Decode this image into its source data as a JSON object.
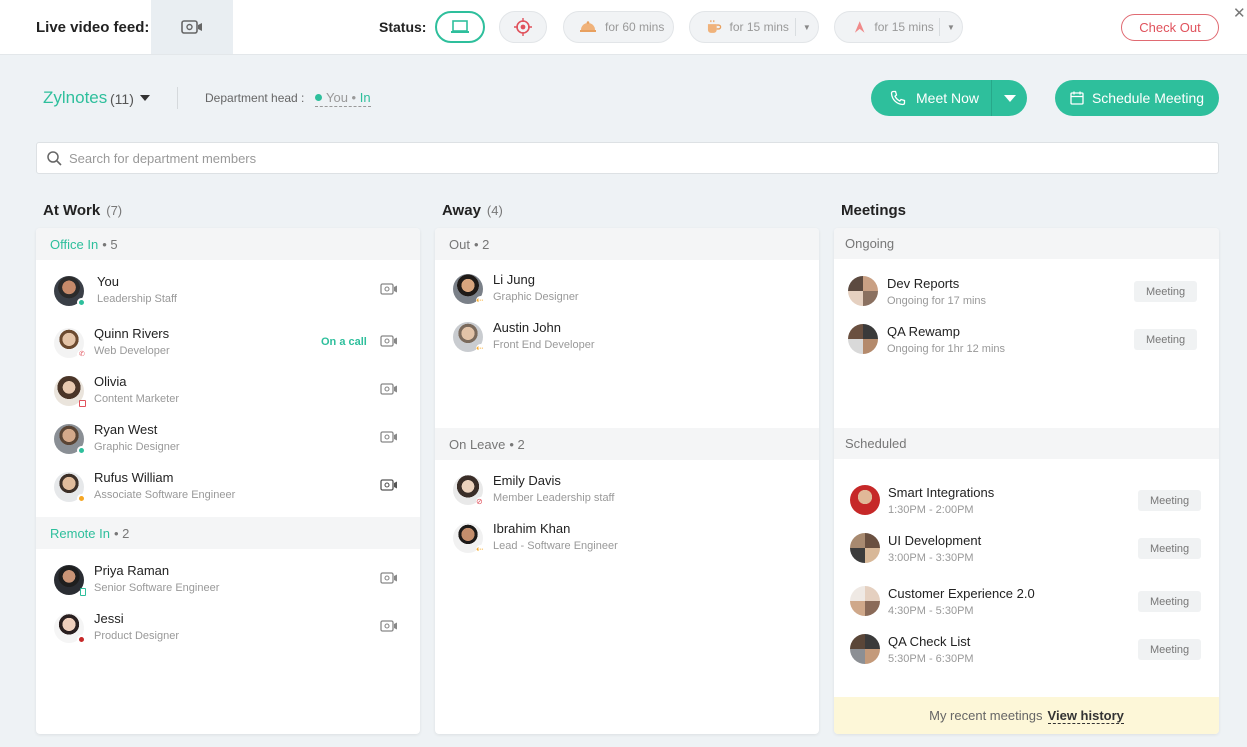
{
  "topbar": {
    "live_label": "Live video feed:",
    "status_label": "Status:",
    "statuses": [
      {
        "icon": "laptop-icon",
        "label": ""
      },
      {
        "icon": "target-icon",
        "label": ""
      },
      {
        "icon": "meal-icon",
        "label": "for 60 mins"
      },
      {
        "icon": "coffee-icon",
        "label": "for 15 mins"
      },
      {
        "icon": "ribbon-icon",
        "label": "for 15 mins"
      }
    ],
    "checkout_label": "Check Out",
    "close_glyph": "✕"
  },
  "header": {
    "dept_name": "Zylnotes",
    "dept_count": "(11)",
    "dept_head_label": "Department head :",
    "dept_head_you": "You",
    "dept_head_sep": " • ",
    "dept_head_in": "In",
    "meet_now_label": "Meet Now",
    "schedule_label": "Schedule Meeting"
  },
  "search": {
    "placeholder": "Search for department members"
  },
  "at_work": {
    "title": "At Work",
    "count": "(7)",
    "office_in": {
      "label": "Office In",
      "count": "• 5"
    },
    "remote_in": {
      "label": "Remote In",
      "count": "• 2"
    },
    "office_members": [
      {
        "name": "You",
        "role": "Leadership Staff",
        "status": "",
        "dot": "#2ebf9c"
      },
      {
        "name": "Quinn Rivers",
        "role": "Web Developer",
        "status": "On a call",
        "dot": "#e0525c"
      },
      {
        "name": "Olivia",
        "role": "Content Marketer",
        "status": "",
        "dot": "#e0525c"
      },
      {
        "name": "Ryan West",
        "role": "Graphic Designer",
        "status": "",
        "dot": "#2ebf9c"
      },
      {
        "name": "Rufus William",
        "role": "Associate Software Engineer",
        "status": "",
        "dot": "#f5a623"
      }
    ],
    "remote_members": [
      {
        "name": "Priya Raman",
        "role": "Senior Software Engineer",
        "dot": "#2ebf9c"
      },
      {
        "name": "Jessi",
        "role": "Product Designer",
        "dot": "#c62828"
      }
    ]
  },
  "away": {
    "title": "Away",
    "count": "(4)",
    "out": {
      "label": "Out",
      "count": "• 2"
    },
    "on_leave": {
      "label": "On Leave",
      "count": "• 2"
    },
    "out_members": [
      {
        "name": "Li Jung",
        "role": "Graphic Designer",
        "dot": "#f5a623"
      },
      {
        "name": "Austin John",
        "role": "Front End Developer",
        "dot": "#f5a623"
      }
    ],
    "leave_members": [
      {
        "name": "Emily Davis",
        "role": "Member Leadership staff",
        "dot": "#e0525c"
      },
      {
        "name": "Ibrahim Khan",
        "role": "Lead - Software Engineer",
        "dot": "#f5a623"
      }
    ]
  },
  "meetings": {
    "title": "Meetings",
    "ongoing_label": "Ongoing",
    "scheduled_label": "Scheduled",
    "badge": "Meeting",
    "ongoing": [
      {
        "name": "Dev Reports",
        "time": "Ongoing for 17 mins"
      },
      {
        "name": "QA Rewamp",
        "time": "Ongoing for 1hr 12 mins"
      }
    ],
    "scheduled": [
      {
        "name": "Smart Integrations",
        "time": "1:30PM - 2:00PM"
      },
      {
        "name": "UI Development",
        "time": "3:00PM - 3:30PM"
      },
      {
        "name": "Customer Experience 2.0",
        "time": "4:30PM - 5:30PM"
      },
      {
        "name": "QA Check List",
        "time": "5:30PM - 6:30PM"
      }
    ],
    "footer_text": "My recent meetings",
    "footer_link": "View history"
  },
  "colors": {
    "accent": "#2ebf9c",
    "danger": "#e0525c",
    "away": "#f5a623"
  }
}
